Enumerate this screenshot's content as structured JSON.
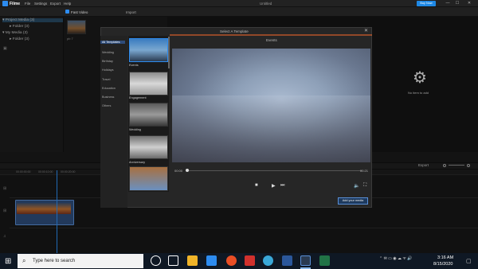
{
  "app": {
    "name": "Filme",
    "menu": [
      "File",
      "Settings",
      "Export",
      "Help"
    ],
    "doc_title": "Untitled",
    "buy_label": "Buy Now",
    "win_min": "—",
    "win_max": "☐",
    "win_close": "✕"
  },
  "media": {
    "tree": [
      "Project Media (3)",
      "Folder (3)",
      "My Media (3)",
      "Folder (3)"
    ],
    "fast_video": "Fast Video",
    "import": "Import",
    "thumb_label": "pb 7",
    "no_item": "No item to add"
  },
  "modal": {
    "title": "Select A Template",
    "close": "✕",
    "category_header": "Events",
    "categories": [
      "All Templates",
      "Wedding",
      "Birthday",
      "Holidays",
      "Travel",
      "Education",
      "Business",
      "Others"
    ],
    "templates": [
      "Events",
      "Engagement",
      "Wedding",
      "Anniversary"
    ],
    "time_start": "00:00",
    "time_end": "00:21",
    "add_button": "Add your media"
  },
  "timeline": {
    "export_label": "Export",
    "ticks": [
      "00:00:00:00",
      "00:00:10:00",
      "00:00:20:00"
    ]
  },
  "taskbar": {
    "search_placeholder": "Type here to search",
    "time": "3:16 AM",
    "date": "8/15/2020"
  },
  "colors": {
    "accent": "#2d8cf0",
    "buy": "#1e88e5",
    "template_bar": "#ff6a2a"
  }
}
